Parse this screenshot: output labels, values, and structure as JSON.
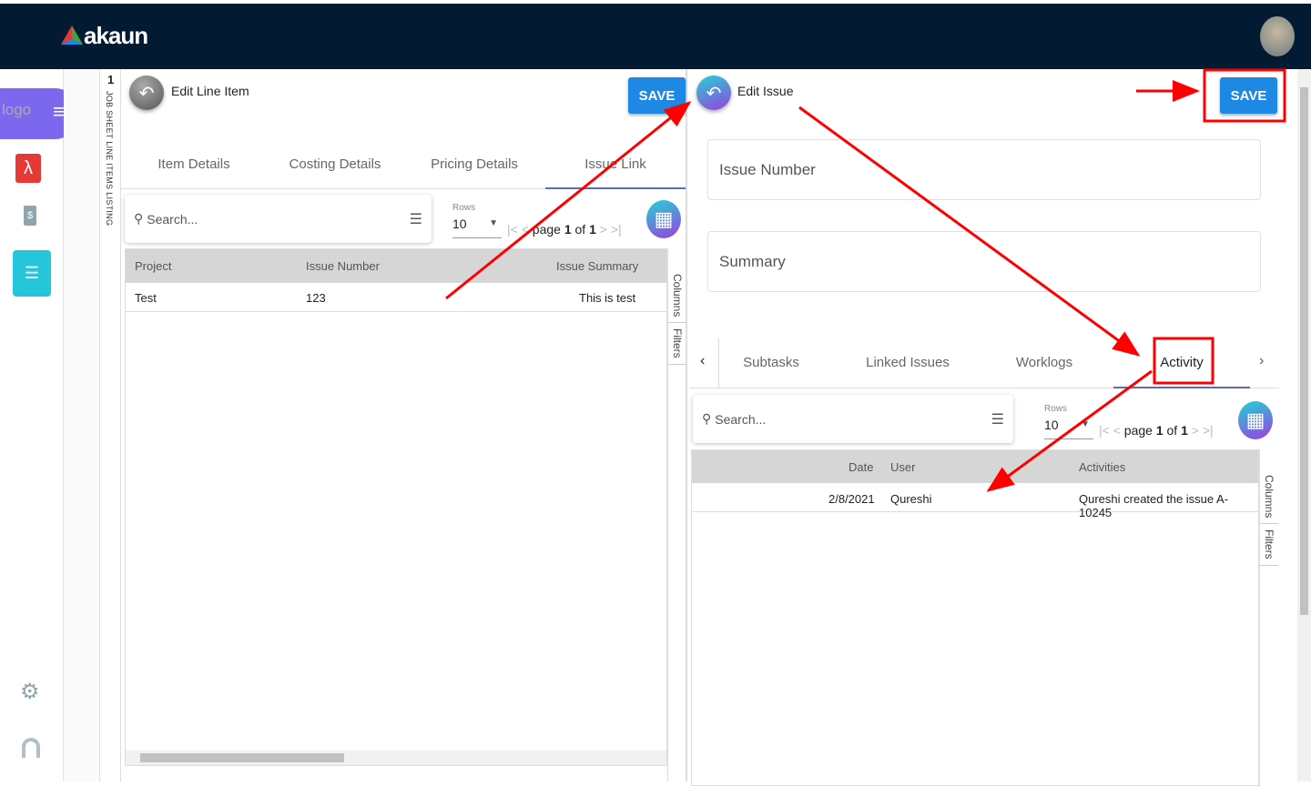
{
  "header": {
    "brand": "akaun",
    "avatar": "user-avatar"
  },
  "sidebar": {
    "logo_alt": "logo",
    "items": [
      {
        "icon": "acrobat-icon"
      },
      {
        "icon": "invoice-dollar-icon"
      },
      {
        "icon": "list-icon",
        "active": true
      },
      {
        "icon": "gear-icon"
      },
      {
        "icon": "user-icon"
      }
    ]
  },
  "strip": {
    "count": "1",
    "label": "JOB SHEET LINE ITEMS LISTING"
  },
  "left": {
    "title": "Edit Line Item",
    "save": "SAVE",
    "tabs": [
      "Item Details",
      "Costing Details",
      "Pricing Details",
      "Issue Link"
    ],
    "active_tab": 3,
    "search_placeholder": "Search...",
    "rows_label": "Rows",
    "rows_value": "10",
    "page_word": "page",
    "page": "1",
    "of_word": "of",
    "pages": "1",
    "columns": [
      "Project",
      "Issue Number",
      "Issue Summary"
    ],
    "rows": [
      [
        "Test",
        "123",
        "This is test"
      ]
    ],
    "side_tabs": [
      "Columns",
      "Filters"
    ]
  },
  "right": {
    "title": "Edit Issue",
    "save": "SAVE",
    "fields": [
      "Issue Number",
      "Summary"
    ],
    "tabs": [
      "Subtasks",
      "Linked Issues",
      "Worklogs",
      "Activity"
    ],
    "active_tab": 3,
    "search_placeholder": "Search...",
    "rows_label": "Rows",
    "rows_value": "10",
    "page_word": "page",
    "page": "1",
    "of_word": "of",
    "pages": "1",
    "columns": [
      "Date",
      "User",
      "Activities"
    ],
    "rows": [
      [
        "2/8/2021",
        "Qureshi",
        "Qureshi created the issue A-10245"
      ]
    ],
    "side_tabs": [
      "Columns",
      "Filters"
    ]
  },
  "colors": {
    "topbar": "#031a33",
    "save": "#1e88e5",
    "annotation": "#ff0000",
    "active_sidebar": "#26c6da",
    "logo_pill": "#7b68ee"
  }
}
